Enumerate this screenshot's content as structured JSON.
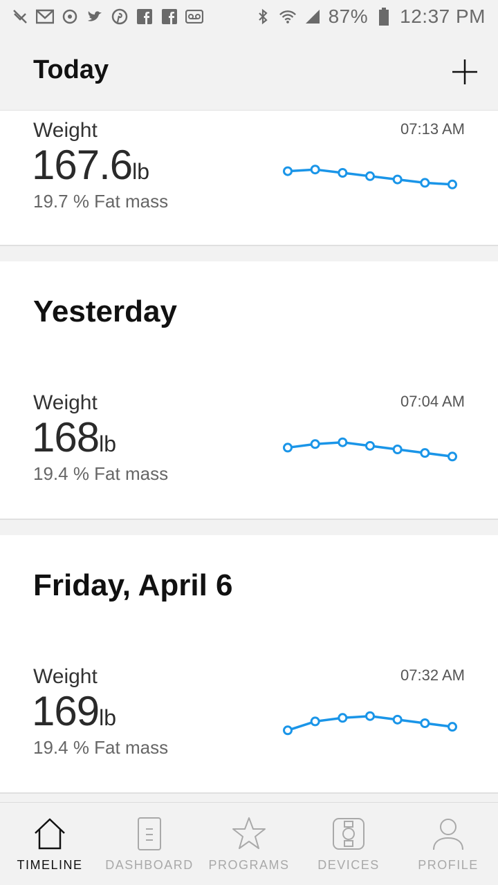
{
  "status_bar": {
    "battery": "87%",
    "time": "12:37 PM",
    "left_icons": [
      "notification-off-icon",
      "gmail-icon",
      "sync-icon",
      "twitter-icon",
      "pinterest-icon",
      "facebook-icon",
      "facebook-icon",
      "voicemail-icon"
    ],
    "right_icons": [
      "bluetooth-icon",
      "wifi-icon",
      "signal-icon",
      "battery-icon"
    ]
  },
  "header": {
    "title": "Today",
    "add_icon": "plus-icon"
  },
  "entries": [
    {
      "heading": "",
      "label": "Weight",
      "value": "167.6",
      "unit": "lb",
      "fat": "19.7 % Fat mass",
      "time": "07:13 AM",
      "trend": [
        167.9,
        168.0,
        167.8,
        167.6,
        167.4,
        167.2,
        167.1
      ]
    },
    {
      "heading": "Yesterday",
      "label": "Weight",
      "value": "168",
      "unit": "lb",
      "fat": "19.4 % Fat mass",
      "time": "07:04 AM",
      "trend": [
        167.8,
        168.0,
        168.1,
        167.9,
        167.7,
        167.5,
        167.3
      ]
    },
    {
      "heading": "Friday, April 6",
      "label": "Weight",
      "value": "169",
      "unit": "lb",
      "fat": "19.4 % Fat mass",
      "time": "07:32 AM",
      "trend": [
        168.0,
        168.5,
        168.7,
        168.8,
        168.6,
        168.4,
        168.2
      ]
    }
  ],
  "nav": [
    {
      "label": "TIMELINE",
      "icon": "home-icon",
      "active": true
    },
    {
      "label": "DASHBOARD",
      "icon": "document-icon",
      "active": false
    },
    {
      "label": "PROGRAMS",
      "icon": "star-icon",
      "active": false
    },
    {
      "label": "DEVICES",
      "icon": "watch-icon",
      "active": false
    },
    {
      "label": "PROFILE",
      "icon": "person-icon",
      "active": false
    }
  ],
  "colors": {
    "accent": "#1a95e8",
    "background": "#f2f2f2",
    "card": "#ffffff"
  }
}
